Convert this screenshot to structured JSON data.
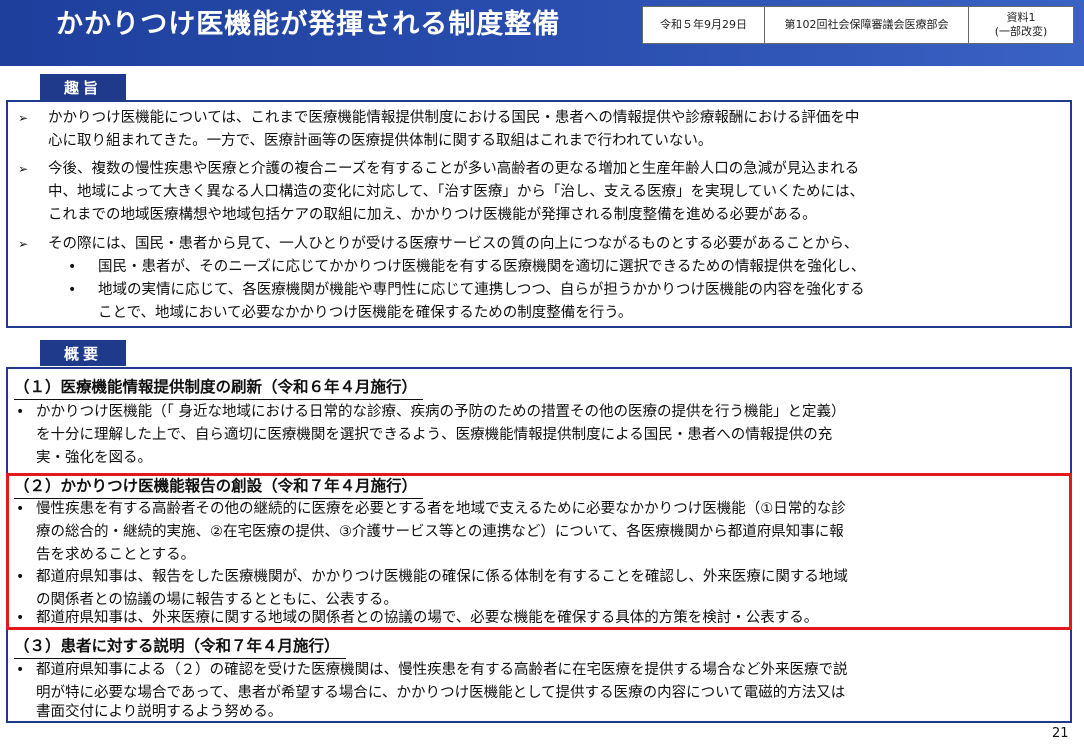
{
  "header": {
    "title": "かかりつけ医機能が発揮される制度整備",
    "date": "令和５年9月29日",
    "council": "第102回社会保障審議会医療部会",
    "doc_label": "資料1",
    "doc_note": "(一部改変)"
  },
  "shushi": {
    "label": "趣旨",
    "items": [
      {
        "lines": [
          "かかりつけ医機能については、これまで医療機能情報提供制度における国民・患者への情報提供や診療報酬における評価を中",
          "心に取り組まれてきた。一方で、医療計画等の医療提供体制に関する取組はこれまで行われていない。"
        ]
      },
      {
        "lines": [
          "今後、複数の慢性疾患や医療と介護の複合ニーズを有することが多い高齢者の更なる増加と生産年齢人口の急減が見込まれる",
          "中、地域によって大きく異なる人口構造の変化に対応して、「治す医療」から「治し、支える医療」を実現していくためには、",
          "これまでの地域医療構想や地域包括ケアの取組に加え、かかりつけ医機能が発揮される制度整備を進める必要がある。"
        ]
      },
      {
        "lines": [
          "その際には、国民・患者から見て、一人ひとりが受ける医療サービスの質の向上につながるものとする必要があることから、"
        ],
        "sub": [
          "国民・患者が、そのニーズに応じてかかりつけ医機能を有する医療機関を適切に選択できるための情報提供を強化し、",
          "地域の実情に応じて、各医療機関が機能や専門性に応じて連携しつつ、自らが担うかかりつけ医機能の内容を強化する",
          "ことで、地域において必要なかかりつけ医機能を確保するための制度整備を行う。"
        ]
      }
    ]
  },
  "gaiyo": {
    "label": "概要",
    "sections": [
      {
        "heading": "（１）医療機能情報提供制度の刷新（令和６年４月施行）",
        "lines": [
          "かかりつけ医機能（「 身近な地域における日常的な診療、疾病の予防のための措置その他の医療の提供を行う機能」と定義）",
          "を十分に理解した上で、自ら適切に医療機関を選択できるよう、医療機能情報提供制度による国民・患者への情報提供の充",
          "実・強化を図る。"
        ]
      },
      {
        "heading": "（２）かかりつけ医機能報告の創設（令和７年４月施行）",
        "lines": [
          "慢性疾患を有する高齢者その他の継続的に医療を必要とする者を地域で支えるために必要なかかりつけ医機能（①日常的な診",
          "療の総合的・継続的実施、②在宅医療の提供、③介護サービス等との連携など）について、各医療機関から都道府県知事に報",
          "告を求めることとする。",
          "都道府県知事は、報告をした医療機関が、かかりつけ医機能の確保に係る体制を有することを確認し、外来医療に関する地域",
          "の関係者との協議の場に報告するとともに、公表する。",
          "都道府県知事は、外来医療に関する地域の関係者との協議の場で、必要な機能を確保する具体的方策を検討・公表する。"
        ]
      },
      {
        "heading": "（３）患者に対する説明（令和７年４月施行）",
        "lines": [
          "都道府県知事による（２）の確認を受けた医療機関は、慢性疾患を有する高齢者に在宅医療を提供する場合など外来医療で説",
          "明が特に必要な場合であって、患者が希望する場合に、かかりつけ医機能として提供する医療の内容について電磁的方法又は",
          "書面交付により説明するよう努める。"
        ]
      }
    ]
  },
  "page_number": "21"
}
